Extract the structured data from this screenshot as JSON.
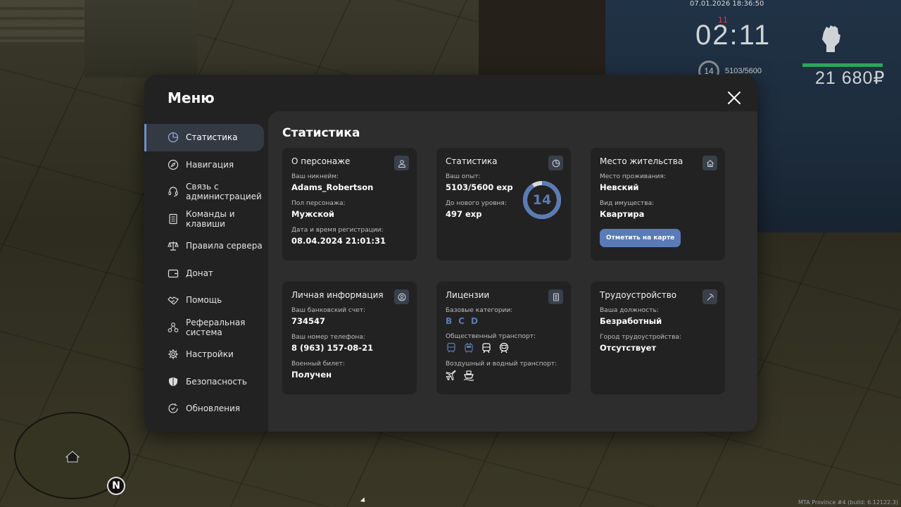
{
  "hud": {
    "datetime": "07.01.2026 18:36:50",
    "marker": "11",
    "clock": "02:11",
    "level": "14",
    "exp": "5103/5600",
    "money": "21 680₽",
    "build": "MTA Province #4 (build: 6.12122.3)"
  },
  "minimap": {
    "north": "N"
  },
  "menu": {
    "title": "Меню",
    "sidebar": [
      {
        "label": "Статистика",
        "icon": "pie-chart-icon"
      },
      {
        "label": "Навигация",
        "icon": "compass-icon"
      },
      {
        "label": "Связь с администрацией",
        "icon": "headset-icon"
      },
      {
        "label": "Команды и клавиши",
        "icon": "document-icon"
      },
      {
        "label": "Правила сервера",
        "icon": "scales-icon"
      },
      {
        "label": "Донат",
        "icon": "wallet-icon"
      },
      {
        "label": "Помощь",
        "icon": "handshake-icon"
      },
      {
        "label": "Реферальная система",
        "icon": "network-icon"
      },
      {
        "label": "Настройки",
        "icon": "gear-icon"
      },
      {
        "label": "Безопасность",
        "icon": "shield-icon"
      },
      {
        "label": "Обновления",
        "icon": "refresh-check-icon"
      }
    ],
    "content_title": "Статистика",
    "character": {
      "title": "О персонаже",
      "nick_label": "Ваш никнейм:",
      "nick": "Adams_Robertson",
      "gender_label": "Пол персонажа:",
      "gender": "Мужской",
      "reg_label": "Дата и время регистрации:",
      "reg": "08.04.2024 21:01:31"
    },
    "stats": {
      "title": "Статистика",
      "exp_label": "Ваш опыт:",
      "exp": "5103/5600 exp",
      "next_label": "До нового уровня:",
      "next": "497 exp",
      "level": "14",
      "progress": 0.911
    },
    "residence": {
      "title": "Место жительства",
      "place_label": "Место проживания:",
      "place": "Невский",
      "type_label": "Вид имущества:",
      "type": "Квартира",
      "button": "Отметить на карте"
    },
    "personal": {
      "title": "Личная информация",
      "bank_label": "Ваш банковский счет:",
      "bank": "734547",
      "phone_label": "Ваш номер телефона:",
      "phone": "8 (963) 157-08-21",
      "military_label": "Военный билет:",
      "military": "Получен"
    },
    "licenses": {
      "title": "Лицензии",
      "base_label": "Базовые категории:",
      "categories": [
        "B",
        "C",
        "D"
      ],
      "public_label": "Общественный транспорт:",
      "public_icons": [
        "bus-icon",
        "trolleybus-icon",
        "tram-icon",
        "metro-icon"
      ],
      "air_label": "Воздушный и водный транспорт:",
      "air_icons": [
        "airplane-icon",
        "ship-icon"
      ]
    },
    "employment": {
      "title": "Трудоустройство",
      "position_label": "Ваша должность:",
      "position": "Безработный",
      "city_label": "Город трудоустройства:",
      "city": "Отсутствует"
    },
    "accent": "#5a7cb6"
  }
}
